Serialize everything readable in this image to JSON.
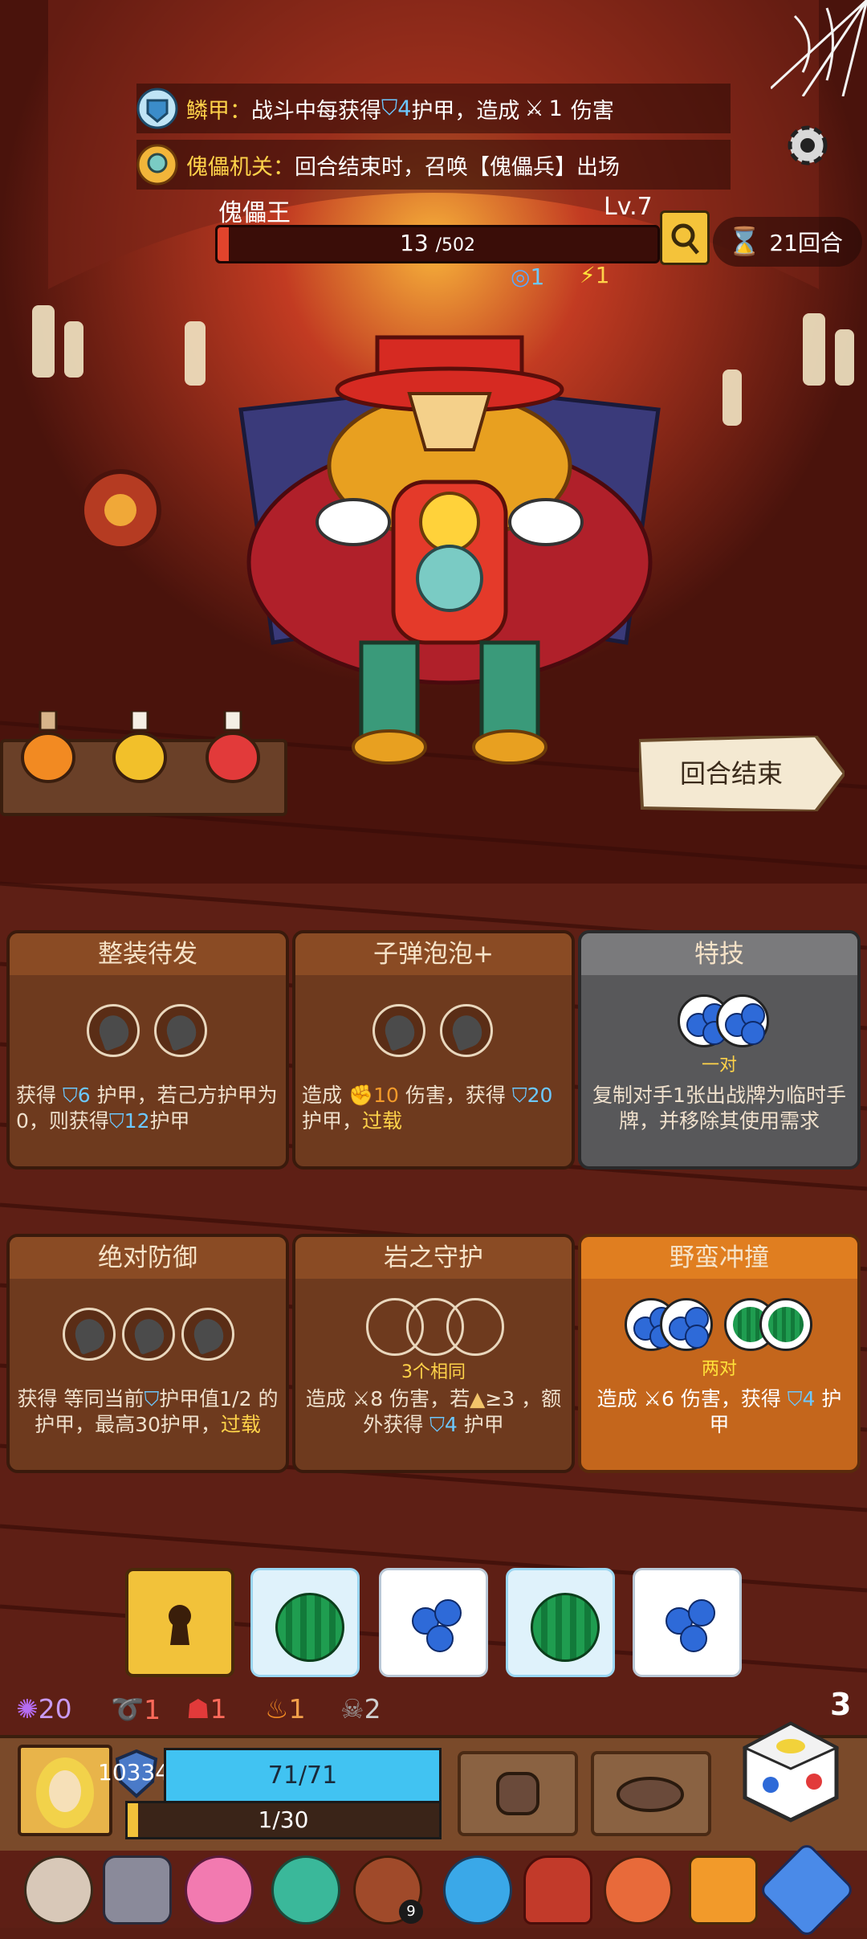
{
  "buffs": [
    {
      "name": "鳞甲",
      "separator": "：",
      "text_a": "战斗中每获得",
      "armor_value": "4",
      "text_b": "护甲，造成",
      "damage_value": "1",
      "text_c": "伤害"
    },
    {
      "name": "傀儡机关",
      "separator": "：",
      "text": "回合结束时，召唤【傀儡兵】出场"
    }
  ],
  "boss": {
    "name": "傀儡王",
    "level": "Lv.7",
    "hp_current": "13",
    "hp_max": "/502",
    "hp_fraction": 0.026,
    "status_cycle": "1",
    "status_energy": "1"
  },
  "turn_counter": "21回合",
  "end_turn_label": "回合结束",
  "potions": [
    "orange-potion",
    "yellow-potion",
    "red-potion"
  ],
  "cards": [
    {
      "title": "整装待发",
      "desc_a": "获得",
      "desc_v1": "6",
      "desc_b": "护甲，若己方护甲为0，则获得",
      "desc_v2": "12",
      "desc_c": "护甲"
    },
    {
      "title": "子弹泡泡+",
      "desc_a": "造成",
      "desc_v1": "10",
      "desc_b": "伤害，获得",
      "desc_v2": "20",
      "desc_c": "护甲，",
      "desc_d": "过载"
    },
    {
      "title": "特技",
      "req": "一对",
      "desc": "复制对手1张出战牌为临时手牌，并移除其使用需求"
    },
    {
      "title": "绝对防御",
      "desc_a": "获得 等同当前",
      "desc_b": "护甲值1/2 的护甲，最高30护甲，",
      "desc_c": "过载"
    },
    {
      "title": "岩之守护",
      "req": "3个相同",
      "desc_a": "造成",
      "desc_v1": "8",
      "desc_b": "伤害，若",
      "desc_v2": "≥3",
      "desc_c": "，额外获得",
      "desc_v3": "4",
      "desc_d": "护甲"
    },
    {
      "title": "野蛮冲撞",
      "req": "两对",
      "desc_a": "造成",
      "desc_v1": "6",
      "desc_b": "伤害，获得",
      "desc_v2": "4",
      "desc_c": "护甲"
    }
  ],
  "dice_pool": [
    "locked-chest",
    "watermelon",
    "blueberry",
    "watermelon",
    "blueberry"
  ],
  "dice_remaining": "3",
  "status_counts": [
    "20",
    "1",
    "1",
    "1",
    "2"
  ],
  "player": {
    "gold": "10334",
    "hp": "71/71",
    "hp_fraction": 1.0,
    "exp": "1/30",
    "exp_fraction": 0.033
  },
  "relic_badge": "9",
  "colors": {
    "accent": "#e07e20",
    "hp": "#41c3f2",
    "boss_hp": "#e2442c",
    "gold_text": "#ffd34a"
  }
}
